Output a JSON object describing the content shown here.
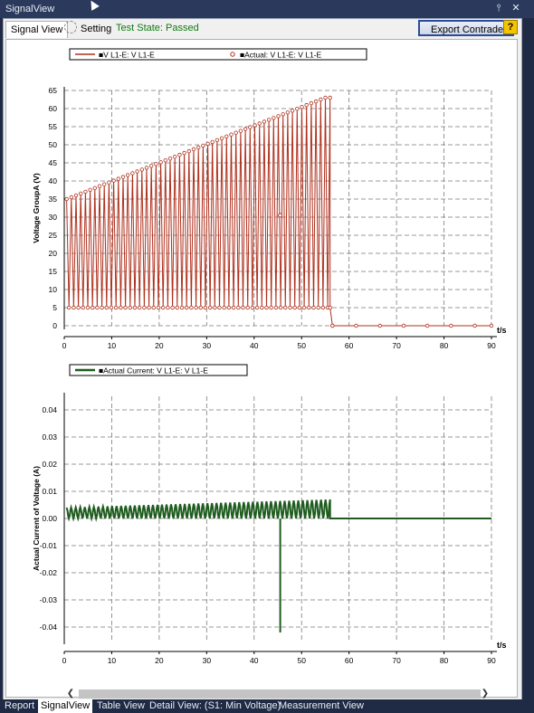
{
  "window": {
    "title": "SignalView",
    "pin_glyph": "⫯",
    "close_glyph": "✕"
  },
  "tabs": {
    "signal_view": "Signal View",
    "setting": "Setting"
  },
  "status": {
    "test_state": "Test State: Passed"
  },
  "toolbar": {
    "export_label": "Export Contrade ...",
    "help_glyph": "?"
  },
  "colors": {
    "voltage_series": "#b0311e",
    "current_series": "#1f5c1f",
    "grid": "#7a7a7a",
    "status_green": "#107c10"
  },
  "chart_data": [
    {
      "type": "line",
      "legend": [
        "■V L1-E: V L1-E",
        "■Actual: V L1-E: V L1-E"
      ],
      "ylabel": "Voltage GroupA (V)",
      "xlabel": "t/s",
      "xlim": [
        0,
        90
      ],
      "ylim": [
        0,
        65
      ],
      "xticks": [
        0,
        10,
        20,
        30,
        40,
        50,
        60,
        70,
        80,
        90
      ],
      "yticks": [
        0,
        5,
        10,
        15,
        20,
        25,
        30,
        35,
        40,
        45,
        50,
        55,
        60,
        65
      ],
      "series": [
        {
          "name": "V L1-E: V L1-E",
          "ramp": {
            "t_start": 0.5,
            "t_end": 56,
            "v_start": 35,
            "v_end": 63,
            "v_low": 5,
            "pulses": 56
          },
          "after": {
            "t_start": 56.5,
            "t_end": 90,
            "v": 0
          }
        },
        {
          "name": "Actual: V L1-E: V L1-E",
          "outlier": {
            "t": 45.5,
            "v": 30.5
          }
        }
      ]
    },
    {
      "type": "line",
      "legend": [
        "■Actual Current: V L1-E: V L1-E"
      ],
      "ylabel": "Actual Current of Voltage (A)",
      "xlabel": "t/s",
      "xlim": [
        0,
        90
      ],
      "ylim": [
        -0.045,
        0.045
      ],
      "xticks": [
        0,
        10,
        20,
        30,
        40,
        50,
        60,
        70,
        80,
        90
      ],
      "yticks": [
        0.04,
        0.03,
        0.02,
        0.01,
        0.0,
        -0.01,
        -0.02,
        -0.03,
        -0.04
      ],
      "ytick_labels": [
        "0.04",
        "0.03",
        "0.02",
        "0.01",
        "0.00",
        "-0.01",
        "-0.02",
        "-0.03",
        "-0.04"
      ],
      "series": [
        {
          "name": "Actual Current: V L1-E: V L1-E",
          "oscillation": {
            "t_start": 0.5,
            "t_end": 56,
            "a_start": 0.004,
            "a_end": 0.007,
            "cycles": 58
          },
          "spike": {
            "t": 45.5,
            "v": -0.042
          },
          "after": {
            "v": 0
          }
        }
      ]
    }
  ],
  "bottom_tabs": [
    "Report",
    "SignalView",
    "Table View",
    "Detail View: (S1: Min Voltage)",
    "Measurement View"
  ]
}
